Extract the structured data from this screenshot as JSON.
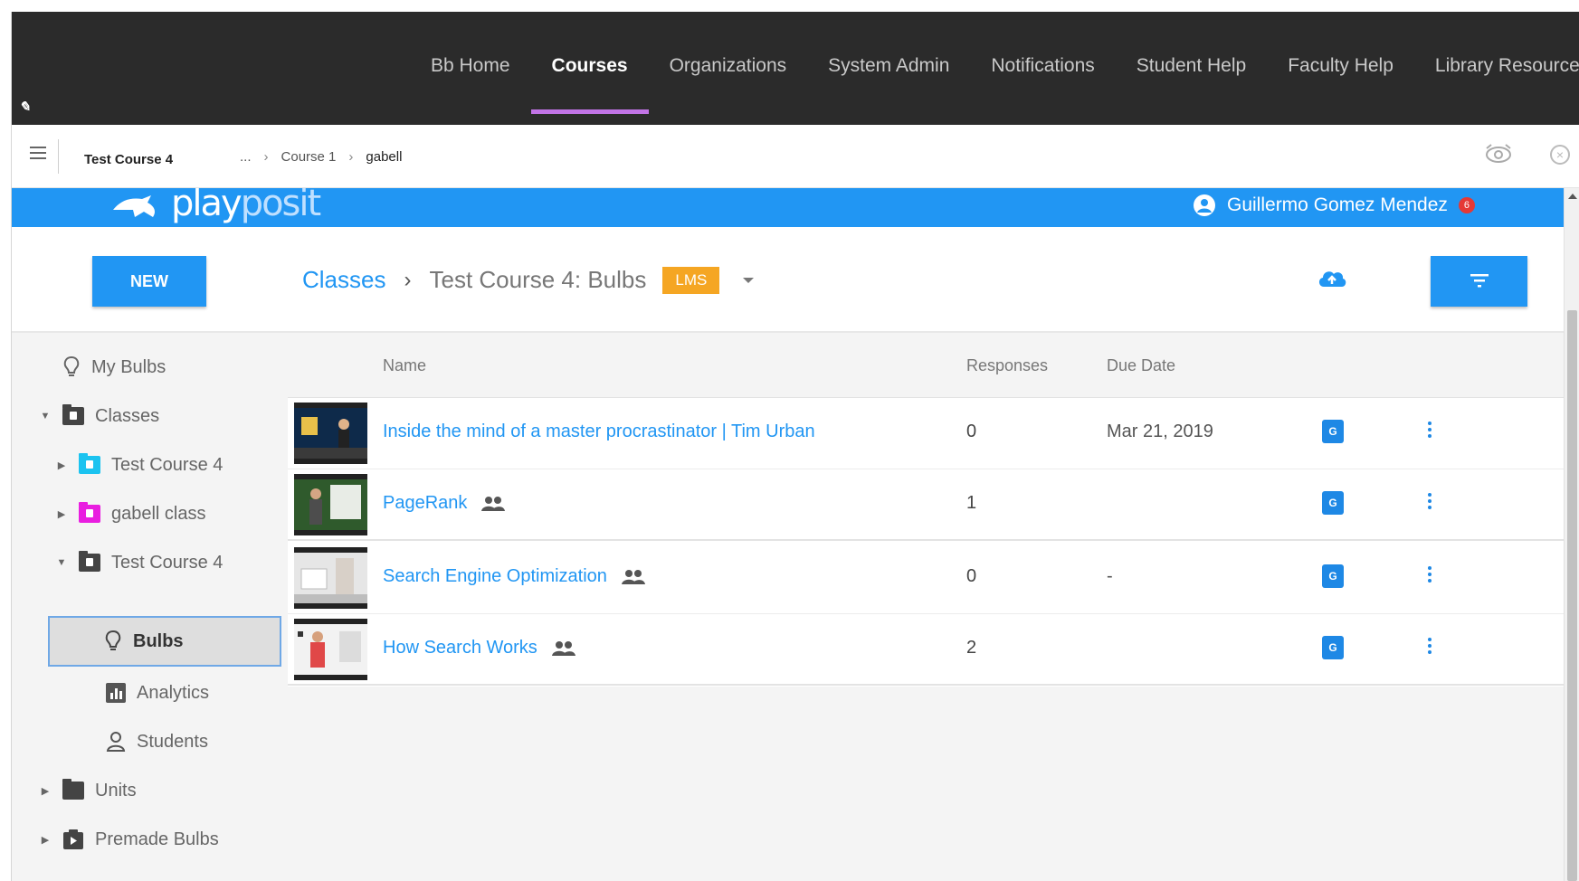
{
  "bb_nav": {
    "items": [
      "Bb Home",
      "Courses",
      "Organizations",
      "System Admin",
      "Notifications",
      "Student Help",
      "Faculty Help",
      "Library Resources"
    ],
    "active_index": 1,
    "accent_color": "#c274e6"
  },
  "breadcrumb_bar": {
    "course_name": "Test Course 4",
    "crumbs": [
      "...",
      "Course 1",
      "gabell"
    ]
  },
  "playposit": {
    "logo_dark": "play",
    "logo_light": "posit",
    "user_name": "Guillermo Gomez Mendez",
    "notification_count": "6",
    "brand_color": "#2196f3"
  },
  "toolbar": {
    "new_label": "NEW",
    "breadcrumb_link": "Classes",
    "breadcrumb_current": "Test Course 4: Bulbs",
    "lms_badge": "LMS",
    "lms_color": "#f5a623"
  },
  "sidebar": {
    "items": [
      {
        "label": "My Bulbs",
        "icon": "bulb-icon"
      },
      {
        "label": "Classes",
        "icon": "folder-icon",
        "expanded": true
      },
      {
        "label": "Test Course 4",
        "icon": "folder-icon",
        "color": "#1bc3f0"
      },
      {
        "label": "gabell class",
        "icon": "folder-icon",
        "color": "#e91ee0"
      },
      {
        "label": "Test Course 4",
        "icon": "folder-icon",
        "expanded": true
      },
      {
        "label": "Bulbs",
        "icon": "bulb-icon",
        "selected": true
      },
      {
        "label": "Analytics",
        "icon": "analytics-icon"
      },
      {
        "label": "Students",
        "icon": "person-icon"
      },
      {
        "label": "Units",
        "icon": "folder-icon"
      },
      {
        "label": "Premade Bulbs",
        "icon": "premade-icon"
      }
    ]
  },
  "table": {
    "headers": {
      "name": "Name",
      "responses": "Responses",
      "due_date": "Due Date"
    },
    "rows": [
      {
        "name": "Inside the mind of a master procrastinator | Tim Urban",
        "responses": "0",
        "due": "Mar 21, 2019",
        "group": false
      },
      {
        "name": "PageRank",
        "responses": "1",
        "due": "",
        "group": true
      },
      {
        "name": "Search Engine Optimization",
        "responses": "0",
        "due": "-",
        "group": true
      },
      {
        "name": "How Search Works",
        "responses": "2",
        "due": "",
        "group": true
      }
    ],
    "lms_icon_text": "G"
  }
}
